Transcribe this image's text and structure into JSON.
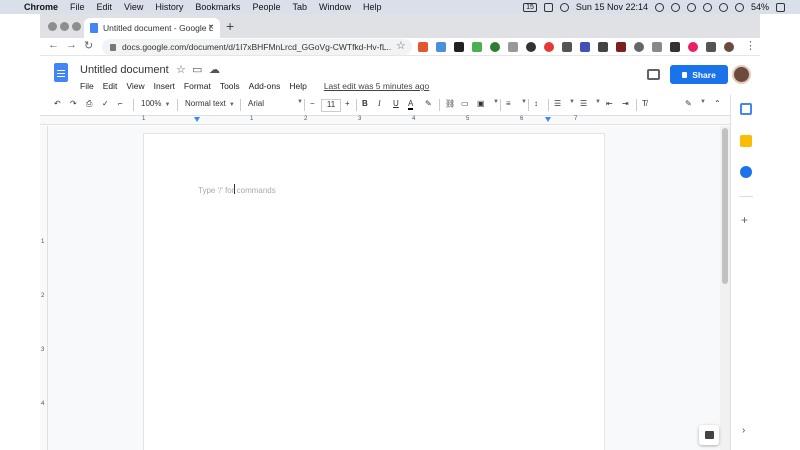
{
  "menubar": {
    "app": "Chrome",
    "items": [
      "File",
      "Edit",
      "View",
      "History",
      "Bookmarks",
      "People",
      "Tab",
      "Window",
      "Help"
    ],
    "date_badge": "15",
    "clock": "Sun 15 Nov 22:14",
    "battery": "54%"
  },
  "browser": {
    "tab_title": "Untitled document - Google D",
    "new_tab": "+",
    "tab_close": "×",
    "url": "docs.google.com/document/d/1I7xBHFMnLrcd_GGoVg-CWTfkd-Hv-fL..."
  },
  "docs": {
    "title": "Untitled document",
    "menus": [
      "File",
      "Edit",
      "View",
      "Insert",
      "Format",
      "Tools",
      "Add-ons",
      "Help"
    ],
    "last_edit": "Last edit was 5 minutes ago",
    "share_label": "Share",
    "zoom": "100%",
    "style": "Normal text",
    "font": "Arial",
    "font_size": "11",
    "ruler_numbers": [
      "1",
      "1",
      "2",
      "3",
      "4",
      "5",
      "6",
      "7"
    ],
    "vruler_numbers": [
      "1",
      "2",
      "3",
      "4"
    ],
    "placeholder": "Type '/' for commands"
  },
  "colors": {
    "brand_blue": "#1a73e8",
    "docs_blue": "#4285f4",
    "keep_yellow": "#fbbc04"
  }
}
